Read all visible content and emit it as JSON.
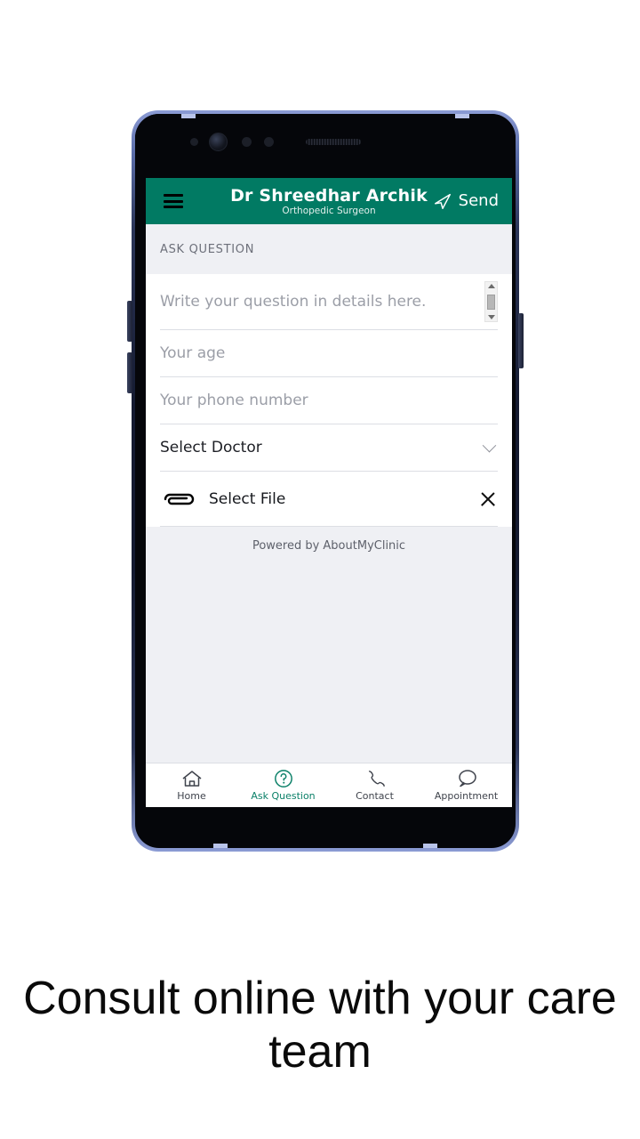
{
  "app": {
    "header": {
      "menu_icon": "hamburger-menu-icon",
      "title": "Dr Shreedhar Archik",
      "subtitle": "Orthopedic Surgeon",
      "send_label": "Send",
      "send_icon": "paper-plane-icon",
      "accent_color": "#017a63"
    },
    "section_label": "ASK QUESTION",
    "form": {
      "question": {
        "placeholder": "Write your question in details here.",
        "value": ""
      },
      "age": {
        "placeholder": "Your age",
        "value": ""
      },
      "phone": {
        "placeholder": "Your phone number",
        "value": ""
      },
      "doctor_select": {
        "value": "Select Doctor",
        "chevron_icon": "chevron-down-icon"
      },
      "file": {
        "label": "Select File",
        "clip_icon": "paperclip-icon",
        "close_icon": "close-x-icon"
      }
    },
    "footer_note": "Powered by AboutMyClinic",
    "bottom_nav": [
      {
        "label": "Home",
        "icon": "home-icon",
        "active": false
      },
      {
        "label": "Ask Question",
        "icon": "question-circle-icon",
        "active": true
      },
      {
        "label": "Contact",
        "icon": "phone-icon",
        "active": false
      },
      {
        "label": "Appointment",
        "icon": "speech-bubble-icon",
        "active": false
      }
    ]
  },
  "caption": "Consult online with your care team"
}
